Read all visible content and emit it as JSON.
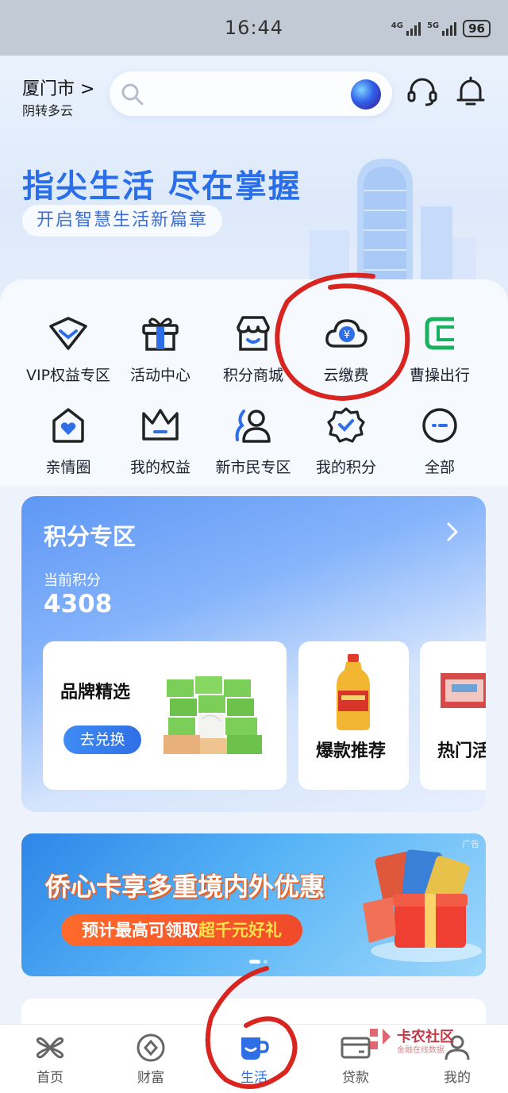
{
  "status_bar": {
    "time": "16:44",
    "net1": "4G",
    "net2": "5G",
    "battery": "96"
  },
  "header": {
    "city": "厦门市 >",
    "weather": "阴转多云",
    "search_placeholder": ""
  },
  "hero": {
    "slogan": "指尖生活 尽在掌握",
    "subtitle": "开启智慧生活新篇章"
  },
  "services": [
    {
      "label": "VIP权益专区",
      "icon": "vip-diamond-icon"
    },
    {
      "label": "活动中心",
      "icon": "gift-icon"
    },
    {
      "label": "积分商城",
      "icon": "store-icon"
    },
    {
      "label": "云缴费",
      "icon": "cloud-yen-icon"
    },
    {
      "label": "曹操出行",
      "icon": "caocao-logo-icon"
    },
    {
      "label": "亲情圈",
      "icon": "family-house-icon"
    },
    {
      "label": "我的权益",
      "icon": "crown-icon"
    },
    {
      "label": "新市民专区",
      "icon": "new-citizen-icon"
    },
    {
      "label": "我的积分",
      "icon": "points-badge-icon"
    },
    {
      "label": "全部",
      "icon": "more-icon"
    }
  ],
  "points_zone": {
    "title": "积分专区",
    "current_label": "当前积分",
    "current_value": "4308",
    "cards": {
      "brand": {
        "title": "品牌精选",
        "button": "去兑换"
      },
      "hot_item": {
        "title": "爆款推荐"
      },
      "hot_event": {
        "title": "热门活"
      }
    }
  },
  "banner": {
    "ad_tag": "广告",
    "headline": "侨心卡享多重境内外优惠",
    "sub_prefix": "预计最高可领取",
    "sub_highlight": "超千元好礼",
    "pages": 2,
    "active_page": 1
  },
  "tabs": [
    {
      "label": "首页",
      "icon": "home-clover-icon"
    },
    {
      "label": "财富",
      "icon": "wealth-icon"
    },
    {
      "label": "生活",
      "icon": "life-cup-icon"
    },
    {
      "label": "贷款",
      "icon": "loan-card-icon"
    },
    {
      "label": "我的",
      "icon": "profile-icon"
    }
  ],
  "active_tab": "生活",
  "watermark": {
    "title": "卡农社区",
    "subtitle": "金融在线数据"
  },
  "colors": {
    "accent": "#2e6fe8",
    "annotation": "#d9251f"
  }
}
